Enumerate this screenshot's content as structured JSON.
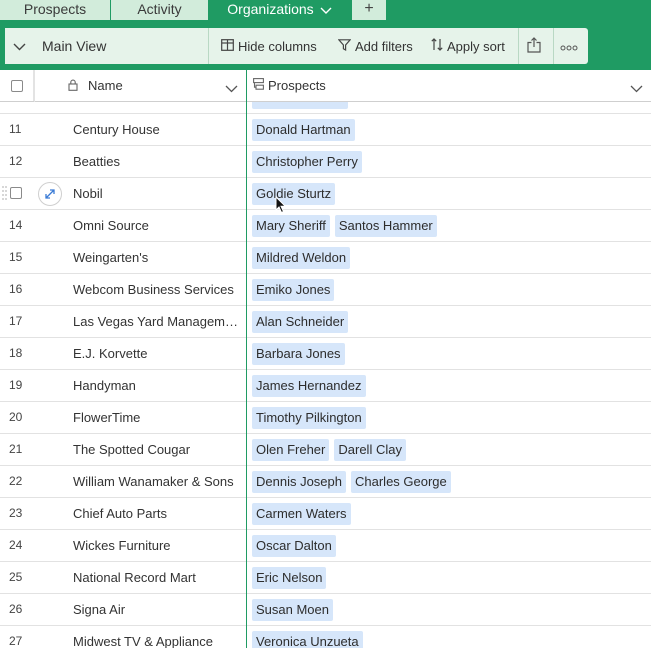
{
  "tabs": [
    {
      "label": "Prospects"
    },
    {
      "label": "Activity"
    },
    {
      "label": "Organizations"
    }
  ],
  "add_tab_label": "+",
  "toolbar": {
    "view_label": "Main View",
    "hide_columns_label": "Hide columns",
    "add_filters_label": "Add filters",
    "apply_sort_label": "Apply sort"
  },
  "columns": {
    "name": "Name",
    "prospects": "Prospects"
  },
  "rows": [
    {
      "num": "",
      "name": "",
      "prospects": [
        ""
      ]
    },
    {
      "num": "11",
      "name": "Century House",
      "prospects": [
        "Donald Hartman"
      ]
    },
    {
      "num": "12",
      "name": "Beatties",
      "prospects": [
        "Christopher Perry"
      ]
    },
    {
      "num": "13",
      "name": "Nobil",
      "prospects": [
        "Goldie Sturtz"
      ]
    },
    {
      "num": "14",
      "name": "Omni Source",
      "prospects": [
        "Mary Sheriff",
        "Santos Hammer"
      ]
    },
    {
      "num": "15",
      "name": "Weingarten's",
      "prospects": [
        "Mildred Weldon"
      ]
    },
    {
      "num": "16",
      "name": "Webcom Business Services",
      "prospects": [
        "Emiko Jones"
      ]
    },
    {
      "num": "17",
      "name": "Las Vegas Yard Managem…",
      "prospects": [
        "Alan Schneider"
      ]
    },
    {
      "num": "18",
      "name": "E.J. Korvette",
      "prospects": [
        "Barbara Jones"
      ]
    },
    {
      "num": "19",
      "name": "Handyman",
      "prospects": [
        "James Hernandez"
      ]
    },
    {
      "num": "20",
      "name": "FlowerTime",
      "prospects": [
        "Timothy Pilkington"
      ]
    },
    {
      "num": "21",
      "name": "The Spotted Cougar",
      "prospects": [
        "Olen Freher",
        "Darell Clay"
      ]
    },
    {
      "num": "22",
      "name": "William Wanamaker & Sons",
      "prospects": [
        "Dennis Joseph",
        "Charles George"
      ]
    },
    {
      "num": "23",
      "name": "Chief Auto Parts",
      "prospects": [
        "Carmen Waters"
      ]
    },
    {
      "num": "24",
      "name": "Wickes Furniture",
      "prospects": [
        "Oscar Dalton"
      ]
    },
    {
      "num": "25",
      "name": "National Record Mart",
      "prospects": [
        "Eric Nelson"
      ]
    },
    {
      "num": "26",
      "name": "Signa Air",
      "prospects": [
        "Susan Moen"
      ]
    },
    {
      "num": "27",
      "name": "Midwest TV & Appliance",
      "prospects": [
        "Veronica Unzueta"
      ]
    }
  ],
  "hovered_row_index": 3,
  "colors": {
    "accent": "#1f9b63",
    "tab_inactive": "#d2ecdb",
    "pill": "#d6e6fa"
  }
}
